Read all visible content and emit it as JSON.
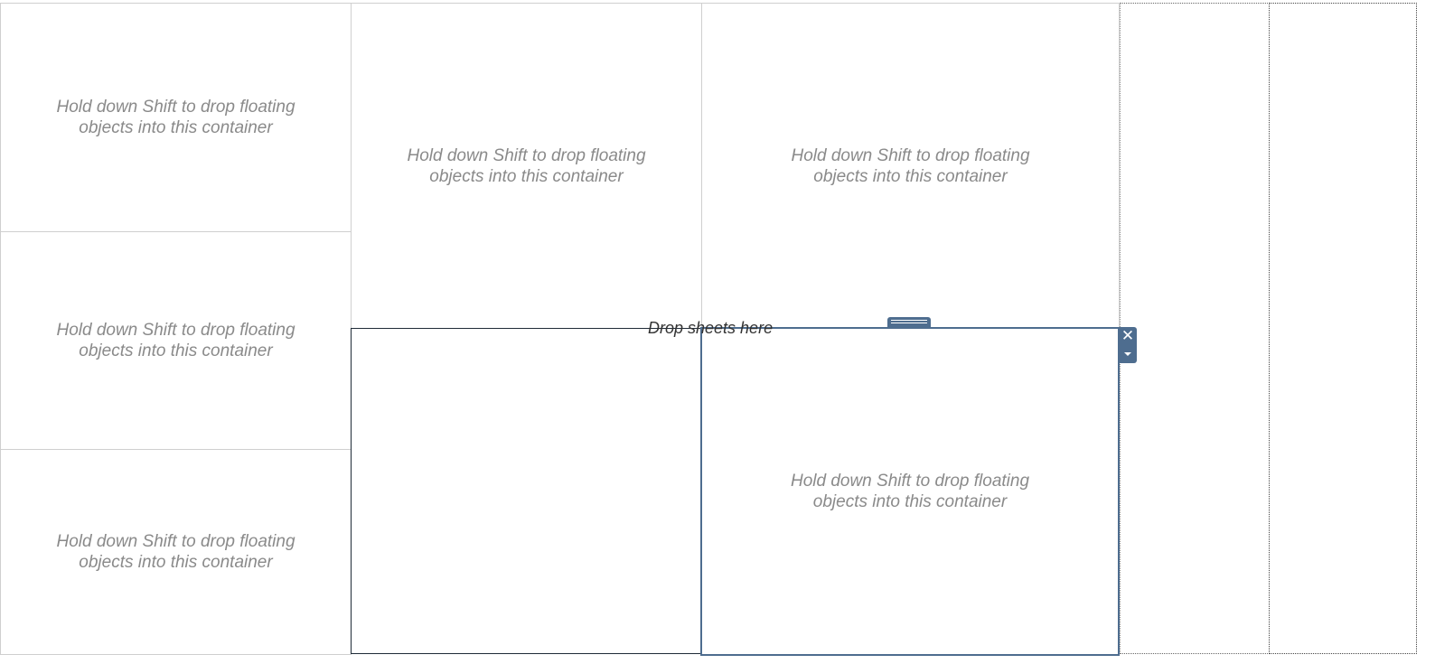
{
  "containers": {
    "placeholder_text": "Hold down Shift to drop floating\nobjects into this container"
  },
  "drop_area": {
    "label": "Drop sheets here"
  },
  "floating_controls": {
    "close_glyph": "✕",
    "close_icon": "close-icon",
    "menu_icon": "chevron-down-icon",
    "move_handle_icon": "grip-icon"
  },
  "colors": {
    "accent": "#4e6d8f",
    "placeholder_text": "#8a8a8a",
    "container_border": "#cfcfcf"
  }
}
